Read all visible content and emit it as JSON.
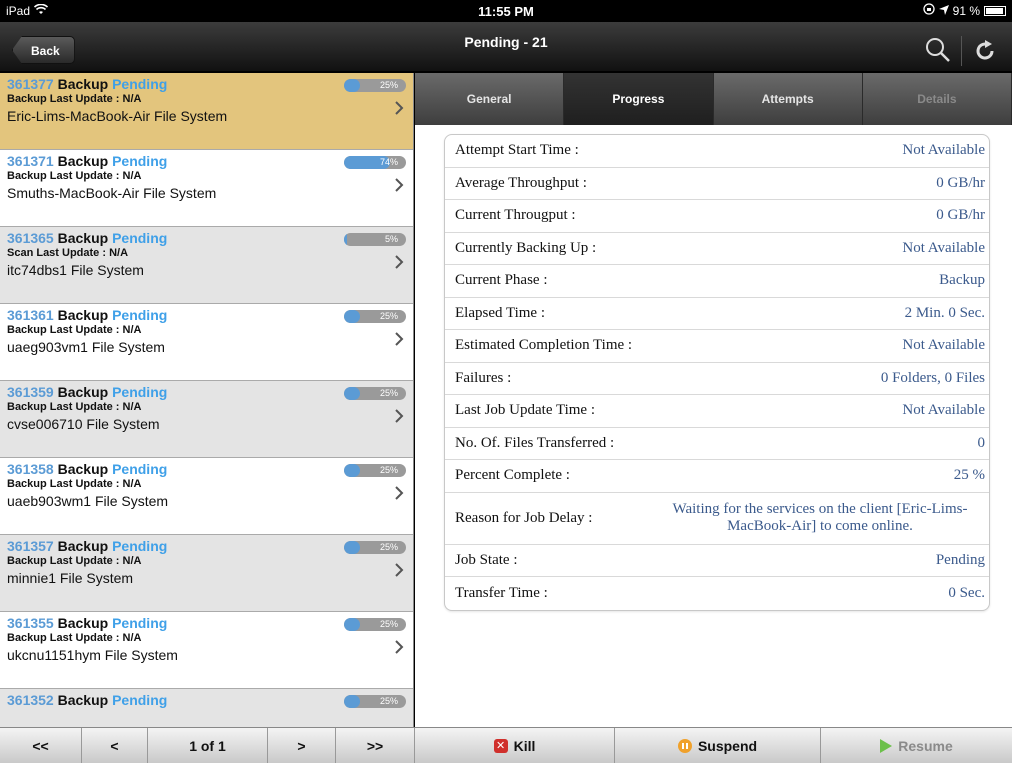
{
  "status_bar": {
    "device": "iPad",
    "time": "11:55 PM",
    "battery": "91 %"
  },
  "nav": {
    "back_label": "Back",
    "title": "Pending - 21"
  },
  "jobs": [
    {
      "id": "361377",
      "type": "Backup",
      "status": "Pending",
      "update": "Backup Last Update : N/A",
      "client": "Eric-Lims-MacBook-Air File System",
      "progress": 0.25,
      "progress_label": "25%"
    },
    {
      "id": "361371",
      "type": "Backup",
      "status": "Pending",
      "update": "Backup Last Update : N/A",
      "client": "Smuths-MacBook-Air File System",
      "progress": 0.74,
      "progress_label": "74%"
    },
    {
      "id": "361365",
      "type": "Backup",
      "status": "Pending",
      "update": "Scan Last Update : N/A",
      "client": "itc74dbs1 File System",
      "progress": 0.05,
      "progress_label": "5%"
    },
    {
      "id": "361361",
      "type": "Backup",
      "status": "Pending",
      "update": "Backup Last Update : N/A",
      "client": "uaeg903vm1 File System",
      "progress": 0.25,
      "progress_label": "25%"
    },
    {
      "id": "361359",
      "type": "Backup",
      "status": "Pending",
      "update": "Backup Last Update : N/A",
      "client": "cvse006710 File System",
      "progress": 0.25,
      "progress_label": "25%"
    },
    {
      "id": "361358",
      "type": "Backup",
      "status": "Pending",
      "update": "Backup Last Update : N/A",
      "client": "uaeb903wm1 File System",
      "progress": 0.25,
      "progress_label": "25%"
    },
    {
      "id": "361357",
      "type": "Backup",
      "status": "Pending",
      "update": "Backup Last Update : N/A",
      "client": "minnie1 File System",
      "progress": 0.25,
      "progress_label": "25%"
    },
    {
      "id": "361355",
      "type": "Backup",
      "status": "Pending",
      "update": "Backup Last Update : N/A",
      "client": "ukcnu1151hym File System",
      "progress": 0.25,
      "progress_label": "25%"
    },
    {
      "id": "361352",
      "type": "Backup",
      "status": "Pending",
      "update": "",
      "client": "",
      "progress": 0.25,
      "progress_label": "25%"
    }
  ],
  "tabs": [
    {
      "label": "General",
      "state": "normal"
    },
    {
      "label": "Progress",
      "state": "active"
    },
    {
      "label": "Attempts",
      "state": "normal"
    },
    {
      "label": "Details",
      "state": "disabled"
    }
  ],
  "details": [
    {
      "label": "Attempt Start Time :",
      "value": "Not Available"
    },
    {
      "label": "Average Throughput :",
      "value": "0 GB/hr"
    },
    {
      "label": "Current Througput :",
      "value": "0 GB/hr"
    },
    {
      "label": "Currently Backing Up :",
      "value": "Not Available"
    },
    {
      "label": "Current Phase :",
      "value": "Backup"
    },
    {
      "label": "Elapsed Time :",
      "value": "2 Min. 0 Sec."
    },
    {
      "label": "Estimated Completion Time :",
      "value": "Not Available"
    },
    {
      "label": "Failures :",
      "value": "0 Folders, 0 Files"
    },
    {
      "label": "Last Job Update Time :",
      "value": "Not Available"
    },
    {
      "label": "No. Of. Files Transferred :",
      "value": "0"
    },
    {
      "label": "Percent Complete :",
      "value": "25 %"
    },
    {
      "label": "Reason for Job Delay :",
      "value": "Waiting for the services on the client [Eric-Lims-MacBook-Air] to come online."
    },
    {
      "label": "Job State :",
      "value": "Pending"
    },
    {
      "label": "Transfer Time :",
      "value": "0 Sec."
    }
  ],
  "pager": {
    "first": "<<",
    "prev": "<",
    "page": "1 of 1",
    "next": ">",
    "last": ">>"
  },
  "actions": {
    "kill": "Kill",
    "suspend": "Suspend",
    "resume": "Resume"
  },
  "colors": {
    "accent": "#3fa0e8",
    "selected_row": "#e3c57d",
    "value_text": "#3b5a8c"
  }
}
